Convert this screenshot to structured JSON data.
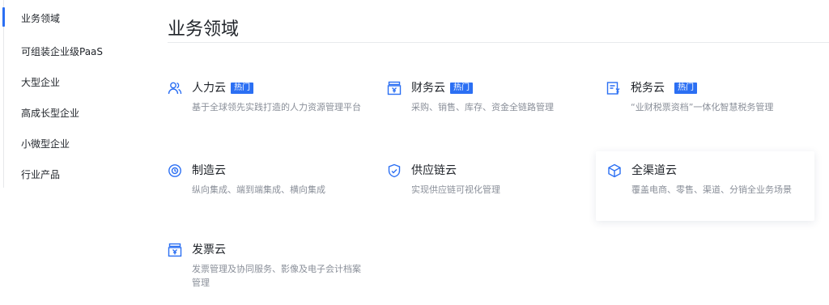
{
  "sidebar": {
    "items": [
      {
        "label": "业务领域"
      },
      {
        "label": "可组装企业级PaaS"
      },
      {
        "label": "大型企业"
      },
      {
        "label": "高成长型企业"
      },
      {
        "label": "小微型企业"
      },
      {
        "label": "行业产品"
      }
    ]
  },
  "main": {
    "title": "业务领域",
    "cards": [
      {
        "name": "人力云",
        "badge": "热门",
        "desc": "基于全球领先实践打造的人力资源管理平台",
        "icon": "people-icon"
      },
      {
        "name": "财务云",
        "badge": "热门",
        "desc": "采购、销售、库存、资金全链路管理",
        "icon": "finance-box-icon"
      },
      {
        "name": "税务云",
        "badge": "热门",
        "desc": "“业财税票资档”一体化智慧税务管理",
        "icon": "tax-document-icon"
      },
      {
        "name": "制造云",
        "desc": "纵向集成、端到端集成、横向集成",
        "icon": "manufacturing-gear-icon"
      },
      {
        "name": "供应链云",
        "desc": "实现供应链可视化管理",
        "icon": "shield-icon"
      },
      {
        "name": "全渠道云",
        "desc": "覆盖电商、零售、渠道、分销全业务场景",
        "icon": "cube-icon"
      },
      {
        "name": "发票云",
        "desc": "发票管理及协同服务、影像及电子会计档案管理",
        "icon": "invoice-box-icon"
      }
    ]
  },
  "colors": {
    "accent": "#2b6ff3",
    "text": "#1f2329",
    "muted": "#8a8f99"
  }
}
